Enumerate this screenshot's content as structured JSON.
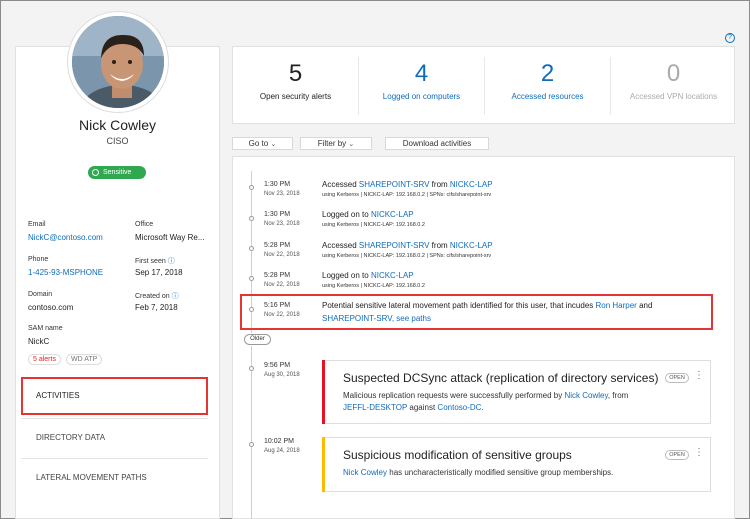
{
  "help_icon": "?",
  "profile": {
    "name": "Nick Cowley",
    "title": "CISO",
    "sensitive_label": "Sensitive",
    "fields": {
      "email_label": "Email",
      "email": "NickC@contoso.com",
      "office_label": "Office",
      "office": "Microsoft Way Re...",
      "phone_label": "Phone",
      "phone": "1-425-93-MSPHONE",
      "first_seen_label": "First seen",
      "first_seen": "Sep 17, 2018",
      "domain_label": "Domain",
      "domain": "contoso.com",
      "created_label": "Created on",
      "created": "Feb 7, 2018",
      "sam_label": "SAM name",
      "sam": "NickC"
    },
    "badges": {
      "alerts": "5 alerts",
      "wd": "WD ATP"
    },
    "nav": {
      "activities": "ACTIVITIES",
      "directory": "DIRECTORY DATA",
      "lateral": "LATERAL MOVEMENT PATHS"
    }
  },
  "stats": [
    {
      "value": "5",
      "label": "Open security alerts"
    },
    {
      "value": "4",
      "label": "Logged on computers"
    },
    {
      "value": "2",
      "label": "Accessed resources"
    },
    {
      "value": "0",
      "label": "Accessed VPN locations"
    }
  ],
  "toolbar": {
    "goto": "Go to",
    "filter": "Filter by",
    "download": "Download activities"
  },
  "activities": [
    {
      "time": "1:30 PM",
      "date": "Nov 23, 2018",
      "pre": "Accessed ",
      "link1": "SHAREPOINT-SRV",
      "mid": " from ",
      "link2": "NICKC-LAP",
      "meta": "using Kerberos | NICKC-LAP: 192.168.0.2 | SPNs: cifs/sharepoint-srv"
    },
    {
      "time": "1:30 PM",
      "date": "Nov 23, 2018",
      "pre": "Logged on to ",
      "link1": "NICKC-LAP",
      "mid": "",
      "link2": "",
      "meta": "using Kerberos | NICKC-LAP: 192.168.0.2"
    },
    {
      "time": "5:28 PM",
      "date": "Nov 22, 2018",
      "pre": "Accessed ",
      "link1": "SHAREPOINT-SRV",
      "mid": " from ",
      "link2": "NICKC-LAP",
      "meta": "using Kerberos | NICKC-LAP: 192.168.0.2 | SPNs: cifs/sharepoint-srv"
    },
    {
      "time": "5:28 PM",
      "date": "Nov 22, 2018",
      "pre": "Logged on to ",
      "link1": "NICKC-LAP",
      "mid": "",
      "link2": "",
      "meta": "using Kerberos | NICKC-LAP: 192.168.0.2"
    }
  ],
  "lateral": {
    "time": "5:16 PM",
    "date": "Nov 22, 2018",
    "text": "Potential sensitive lateral movement path identified for this user, that incudes ",
    "link1": "Ron Harper",
    "and": " and",
    "link2": "SHAREPOINT-SRV",
    "comma": ", ",
    "link3": "see paths"
  },
  "older": "Older",
  "alerts": [
    {
      "time": "9:56 PM",
      "date": "Aug 30, 2018",
      "title": "Suspected DCSync attack (replication of directory services)",
      "status": "OPEN",
      "body1": "Malicious replication requests were successfully performed by ",
      "link1": "Nick Cowley",
      "body2": ", from",
      "link2": "JEFFL-DESKTOP",
      "body3": " against ",
      "link3": "Contoso-DC",
      "body4": ".",
      "color": "#e81123"
    },
    {
      "time": "10:02 PM",
      "date": "Aug 24, 2018",
      "title": "Suspicious modification of sensitive groups",
      "status": "OPEN",
      "link1": "Nick Cowley",
      "body1": " has uncharacteristically modified sensitive group memberships.",
      "color": "#ffb900"
    }
  ]
}
